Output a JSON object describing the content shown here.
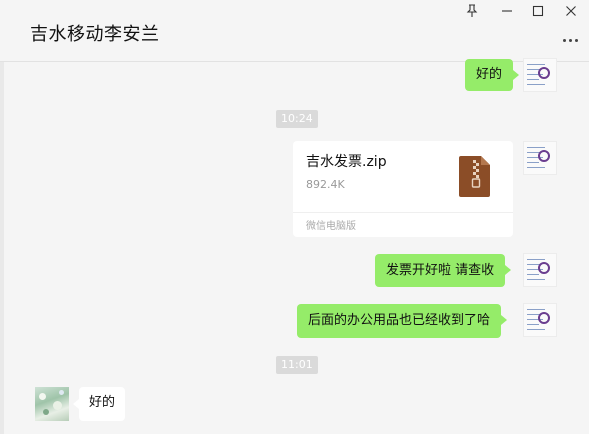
{
  "window": {
    "title": "吉水移动李安兰",
    "controls": {
      "pin": "pin-icon",
      "minimize": "minimize-icon",
      "maximize": "maximize-icon",
      "close": "close-icon"
    }
  },
  "messages": [
    {
      "type": "text",
      "side": "right",
      "text": "好的"
    },
    {
      "type": "timestamp",
      "text": "10:24"
    },
    {
      "type": "file",
      "side": "right",
      "file_name": "吉水发票.zip",
      "file_size": "892.4K",
      "source": "微信电脑版",
      "icon": "zip-file-icon"
    },
    {
      "type": "text",
      "side": "right",
      "text": "发票开好啦 请查收"
    },
    {
      "type": "text",
      "side": "right",
      "text": "后面的办公用品也已经收到了哈"
    },
    {
      "type": "timestamp",
      "text": "11:01"
    },
    {
      "type": "text",
      "side": "left",
      "text": "好的"
    }
  ],
  "colors": {
    "self_bubble": "#95ec69",
    "other_bubble": "#ffffff",
    "background": "#f5f5f5",
    "zip_icon": "#8b4d27"
  }
}
